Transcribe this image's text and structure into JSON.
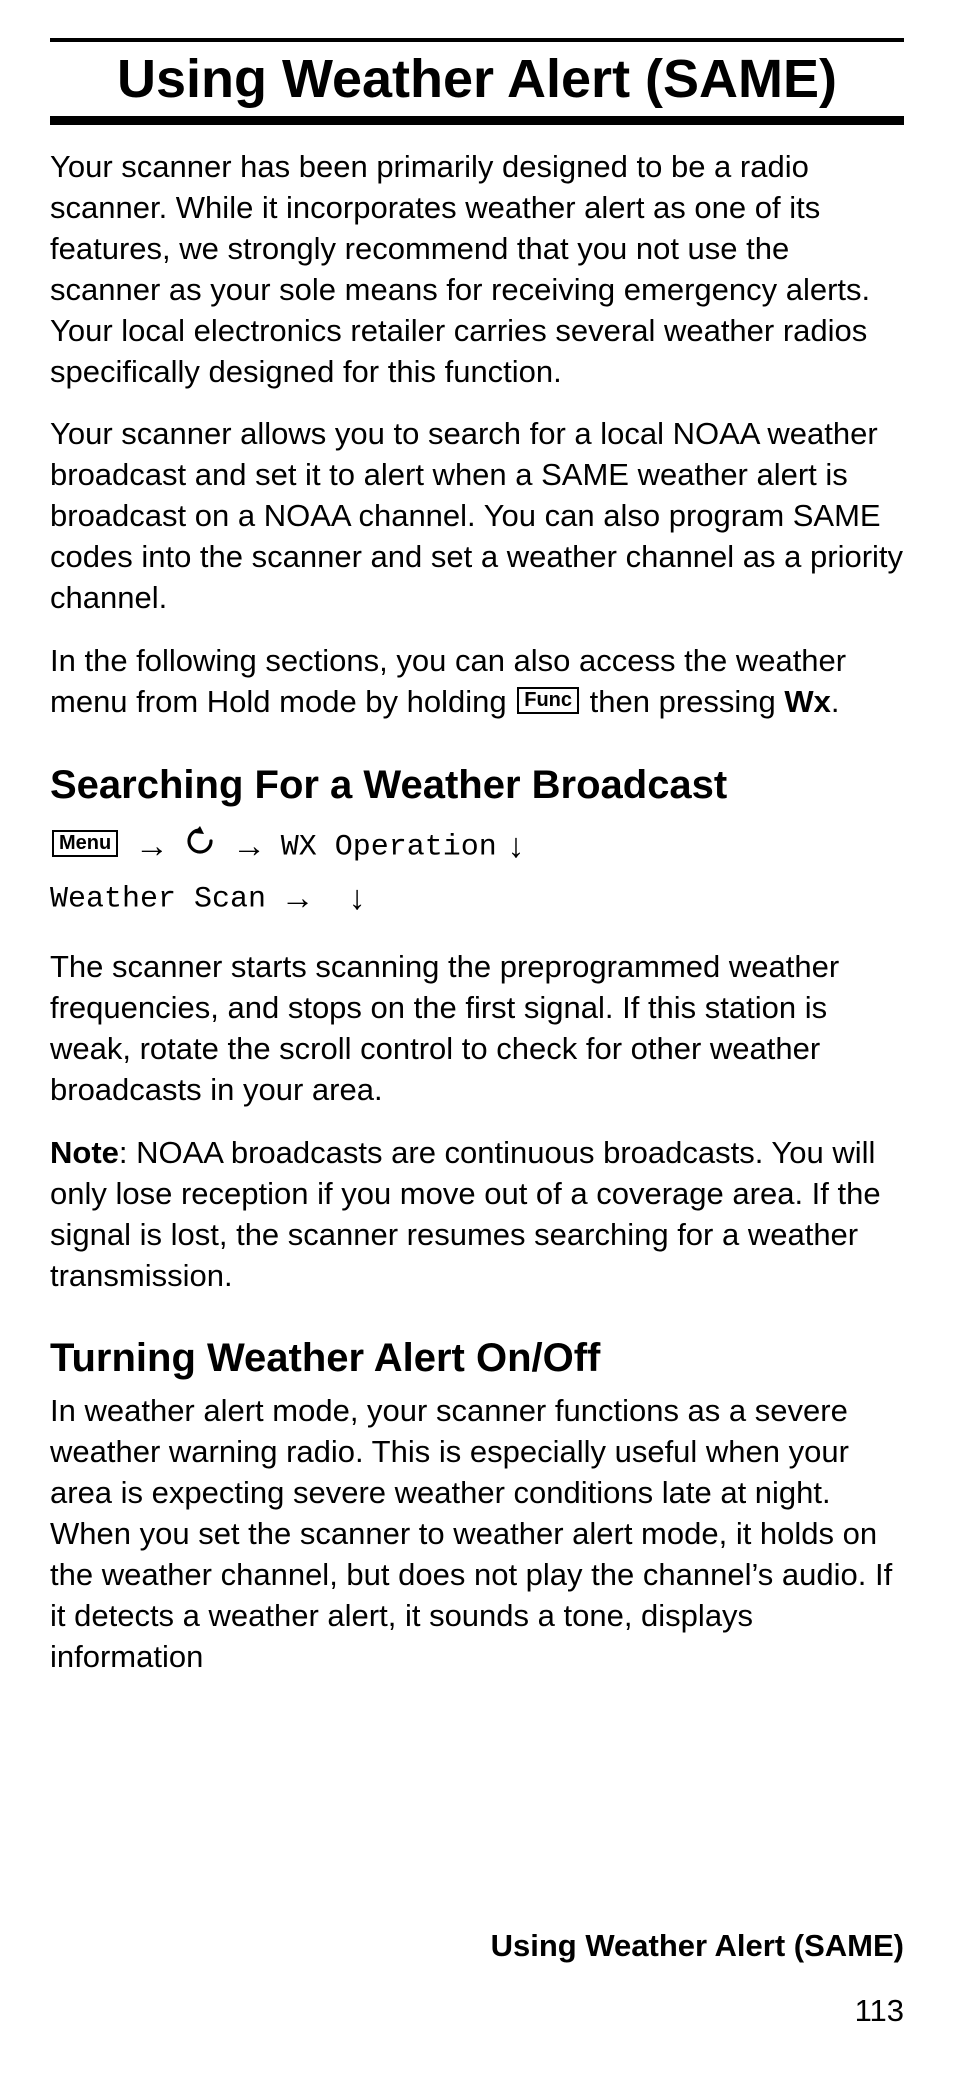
{
  "chapter_title": "Using Weather Alert (SAME)",
  "p1": "Your scanner has been primarily designed to be a radio scanner. While it incorporates weather alert as one of its features, we strongly recommend that you not use the scanner as your sole means for receiving emergency alerts. Your local electronics retailer carries several weather radios specifically designed for this function.",
  "p2": "Your scanner allows you to search for a local NOAA weather broadcast and set it to alert when a SAME weather alert is broadcast on a NOAA channel. You can also program SAME codes into the scanner and set a weather channel as a priority channel.",
  "p3a": "In the following sections, you can also access the weather menu from Hold mode by holding ",
  "key_func": "Func",
  "p3b": " then pressing ",
  "p3_wx": "Wx",
  "p3c": ".",
  "section1_title": "Searching For a Weather Broadcast",
  "key_menu": "Menu",
  "arrow_right": "→",
  "arrow_down": "↓",
  "nav_wx_operation": "WX Operation",
  "nav_weather_scan": "Weather Scan",
  "p4": "The scanner starts scanning the preprogrammed weather frequencies, and stops on the first signal. If this station is weak, rotate the scroll control to check for other weather broadcasts in your area.",
  "p5_note_label": "Note",
  "p5_note_body": ": NOAA broadcasts are continuous broadcasts. You will only lose reception if you move out of a coverage area. If the signal is lost, the scanner resumes searching for a weather transmission.",
  "section2_title": "Turning Weather Alert On/Off",
  "p6": "In weather alert mode, your scanner functions as a severe weather warning radio. This is especially useful when your area is expecting severe weather conditions late at night. When you set the scanner to weather alert mode, it holds on the weather channel, but does not play the channel’s audio. If it detects a weather alert, it sounds a tone, displays information",
  "footer_title": "Using Weather Alert (SAME)",
  "footer_page": "113"
}
